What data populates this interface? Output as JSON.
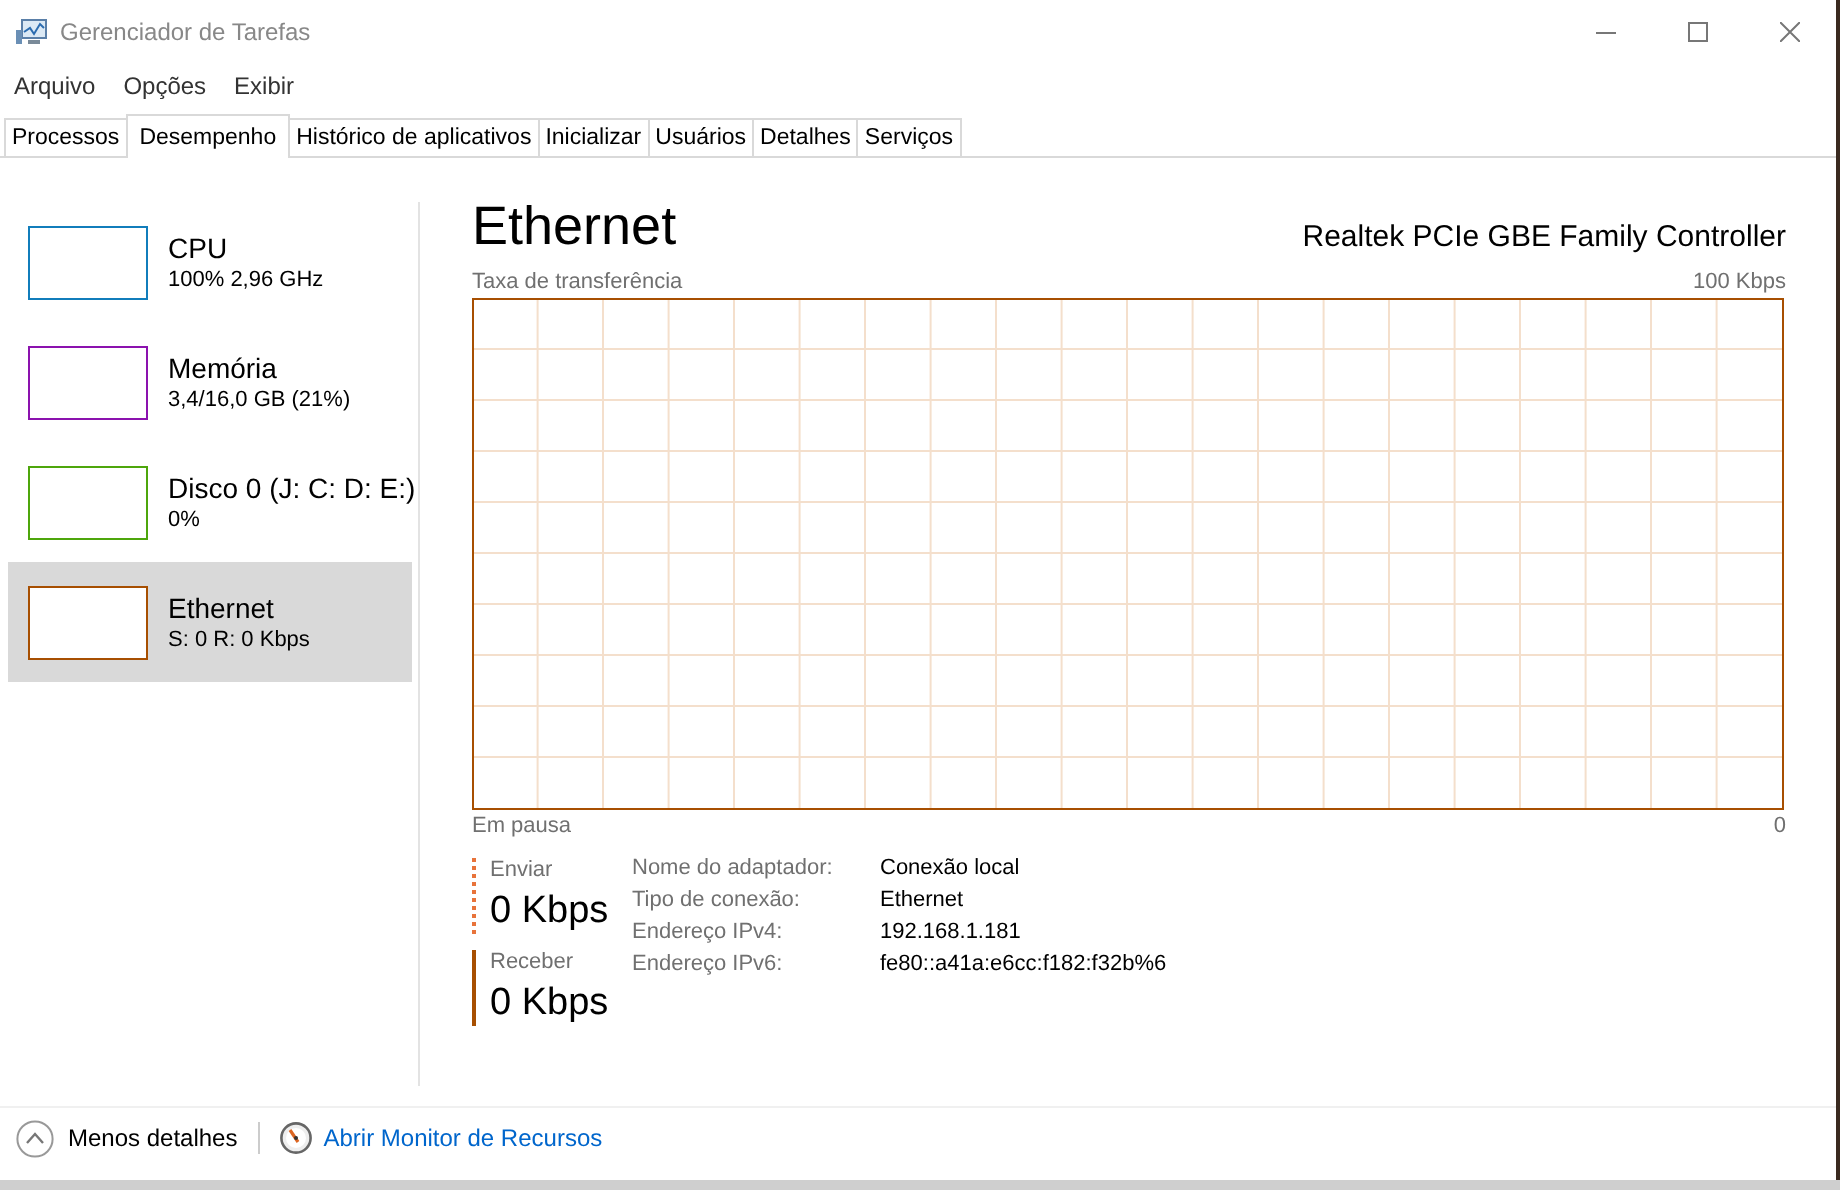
{
  "window": {
    "title": "Gerenciador de Tarefas"
  },
  "menu": [
    "Arquivo",
    "Opções",
    "Exibir"
  ],
  "tabs": [
    {
      "label": "Processos",
      "selected": false
    },
    {
      "label": "Desempenho",
      "selected": true
    },
    {
      "label": "Histórico de aplicativos",
      "selected": false
    },
    {
      "label": "Inicializar",
      "selected": false
    },
    {
      "label": "Usuários",
      "selected": false
    },
    {
      "label": "Detalhes",
      "selected": false
    },
    {
      "label": "Serviços",
      "selected": false
    }
  ],
  "sidebar": {
    "items": [
      {
        "name": "CPU",
        "detail": "100% 2,96 GHz",
        "color": "#117dbb",
        "selected": false
      },
      {
        "name": "Memória",
        "detail": "3,4/16,0 GB (21%)",
        "color": "#8b12ae",
        "selected": false
      },
      {
        "name": "Disco 0 (J: C: D: E:)",
        "detail": "0%",
        "color": "#4da60c",
        "selected": false
      },
      {
        "name": "Ethernet",
        "detail": "S: 0 R: 0 Kbps",
        "color": "#a74f01",
        "selected": true
      }
    ]
  },
  "panel": {
    "title": "Ethernet",
    "device": "Realtek PCIe GBE Family Controller",
    "graph": {
      "label": "Taxa de transferência",
      "max": "100 Kbps",
      "status": "Em pausa",
      "min": "0"
    },
    "throughput": [
      {
        "label": "Enviar",
        "value": "0 Kbps",
        "kind": "dotted"
      },
      {
        "label": "Receber",
        "value": "0 Kbps",
        "kind": "solid"
      }
    ],
    "properties": [
      {
        "label": "Nome do adaptador:",
        "value": "Conexão local"
      },
      {
        "label": "Tipo de conexão:",
        "value": "Ethernet"
      },
      {
        "label": "Endereço IPv4:",
        "value": "192.168.1.181"
      },
      {
        "label": "Endereço IPv6:",
        "value": "fe80::a41a:e6cc:f182:f32b%6"
      }
    ]
  },
  "footer": {
    "less_details": "Menos detalhes",
    "resource_monitor": "Abrir Monitor de Recursos"
  }
}
